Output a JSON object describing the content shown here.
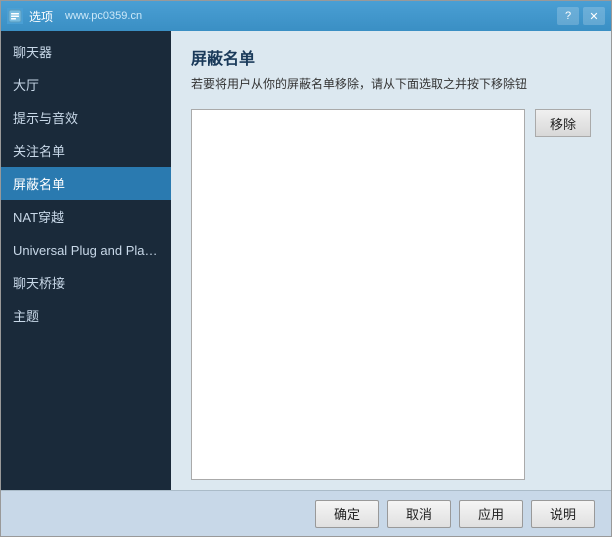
{
  "titleBar": {
    "appName": "选项",
    "watermark": "www.pc0359.cn",
    "helpBtn": "?",
    "closeBtn": "✕"
  },
  "sidebar": {
    "items": [
      {
        "label": "聊天器",
        "active": false
      },
      {
        "label": "大厅",
        "active": false
      },
      {
        "label": "提示与音效",
        "active": false
      },
      {
        "label": "关注名单",
        "active": false
      },
      {
        "label": "屏蔽名单",
        "active": true
      },
      {
        "label": "NAT穿越",
        "active": false
      },
      {
        "label": "Universal Plug and Play（UI",
        "active": false
      },
      {
        "label": "聊天桥接",
        "active": false
      },
      {
        "label": "主题",
        "active": false
      }
    ]
  },
  "panel": {
    "title": "屏蔽名单",
    "description": "若要将用户从你的屏蔽名单移除，请从下面选取之并按下移除钮"
  },
  "removeButton": "移除",
  "footer": {
    "ok": "确定",
    "cancel": "取消",
    "apply": "应用",
    "help": "说明"
  }
}
